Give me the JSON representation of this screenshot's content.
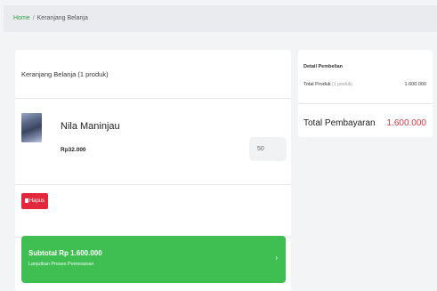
{
  "breadcrumb": {
    "home": "Home",
    "separator": "/",
    "current": "Keranjang Belanja"
  },
  "cart": {
    "header": "Keranjang Belanja (1 produk)",
    "product": {
      "name": "Nila Maninjau",
      "price": "Rp32.000",
      "quantity": "50"
    },
    "remove_label": "Hapus",
    "checkout": {
      "subtotal": "Subtotal Rp 1.600.000",
      "hint": "Lanjutkan Proses Pemesanan",
      "chevron": "›"
    }
  },
  "summary": {
    "title": "Detail Pembelian",
    "total_product_label": "Total Produk",
    "total_product_count": "(1 produk)",
    "total_product_value": "1.600.000",
    "total_payment_label": "Total Pembayaran",
    "total_payment_value": "1.600.000"
  },
  "colors": {
    "accent": "#3fbf52",
    "danger": "#e2283c",
    "total": "#d63a47",
    "link": "#2e9e4a"
  }
}
